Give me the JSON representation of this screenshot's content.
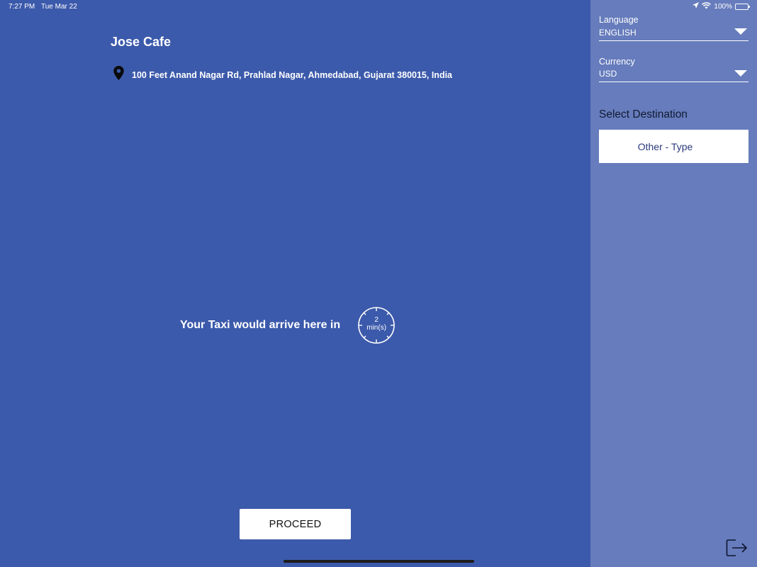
{
  "status_bar": {
    "time": "7:27 PM",
    "date": "Tue Mar 22",
    "battery": "100%"
  },
  "main": {
    "place_name": "Jose Cafe",
    "address": "100 Feet Anand Nagar Rd, Prahlad Nagar, Ahmedabad, Gujarat 380015, India",
    "arrival_text": "Your Taxi would arrive here in",
    "timer_value": "2",
    "timer_unit": "min(s)",
    "proceed_label": "PROCEED"
  },
  "sidebar": {
    "language_label": "Language",
    "language_value": "ENGLISH",
    "currency_label": "Currency",
    "currency_value": "USD",
    "select_destination_title": "Select Destination",
    "destination_option": "Other - Type"
  },
  "colors": {
    "main_background": "#3c5aab",
    "sidebar_background": "#667cbc",
    "button_background": "#ffffff"
  }
}
